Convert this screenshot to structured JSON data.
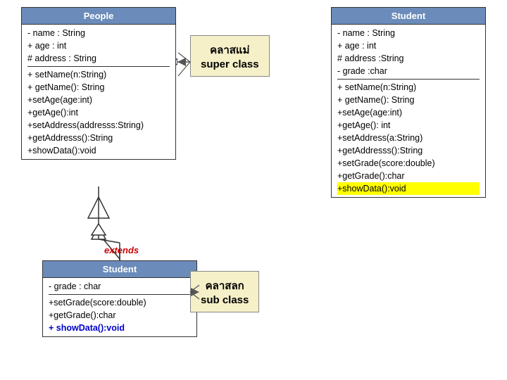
{
  "people_box": {
    "header": "People",
    "fields": [
      "- name : String",
      "+ age : int",
      "# address : String"
    ],
    "methods": [
      "+ setName(n:String)",
      "+ getName(): String",
      "+setAge(age:int)",
      "+getAge():int",
      "+setAddress(addresss:String)",
      "+getAddresss():String",
      "+showData():void"
    ]
  },
  "student_box_top": {
    "header": "Student",
    "fields": [
      "- name : String",
      "+ age : int",
      "# address :String",
      "- grade :char"
    ],
    "methods": [
      "+ setName(n:String)",
      "+ getName(): String",
      "+setAge(age:int)",
      "+getAge(): int",
      "+setAddress(a:String)",
      "+getAddresss():String",
      "+setGrade(score:double)",
      "+getGrade():char",
      "+showData():void"
    ]
  },
  "student_box_bottom": {
    "header": "Student",
    "fields": [
      "- grade : char"
    ],
    "methods": [
      "+setGrade(score:double)",
      "+getGrade():char",
      "+ showData():void"
    ]
  },
  "callout_top": {
    "line1": "คลาสแม่",
    "line2": "super class"
  },
  "callout_bottom": {
    "line1": "คลาสลก",
    "line2": "sub class"
  },
  "extends_label": "extends"
}
